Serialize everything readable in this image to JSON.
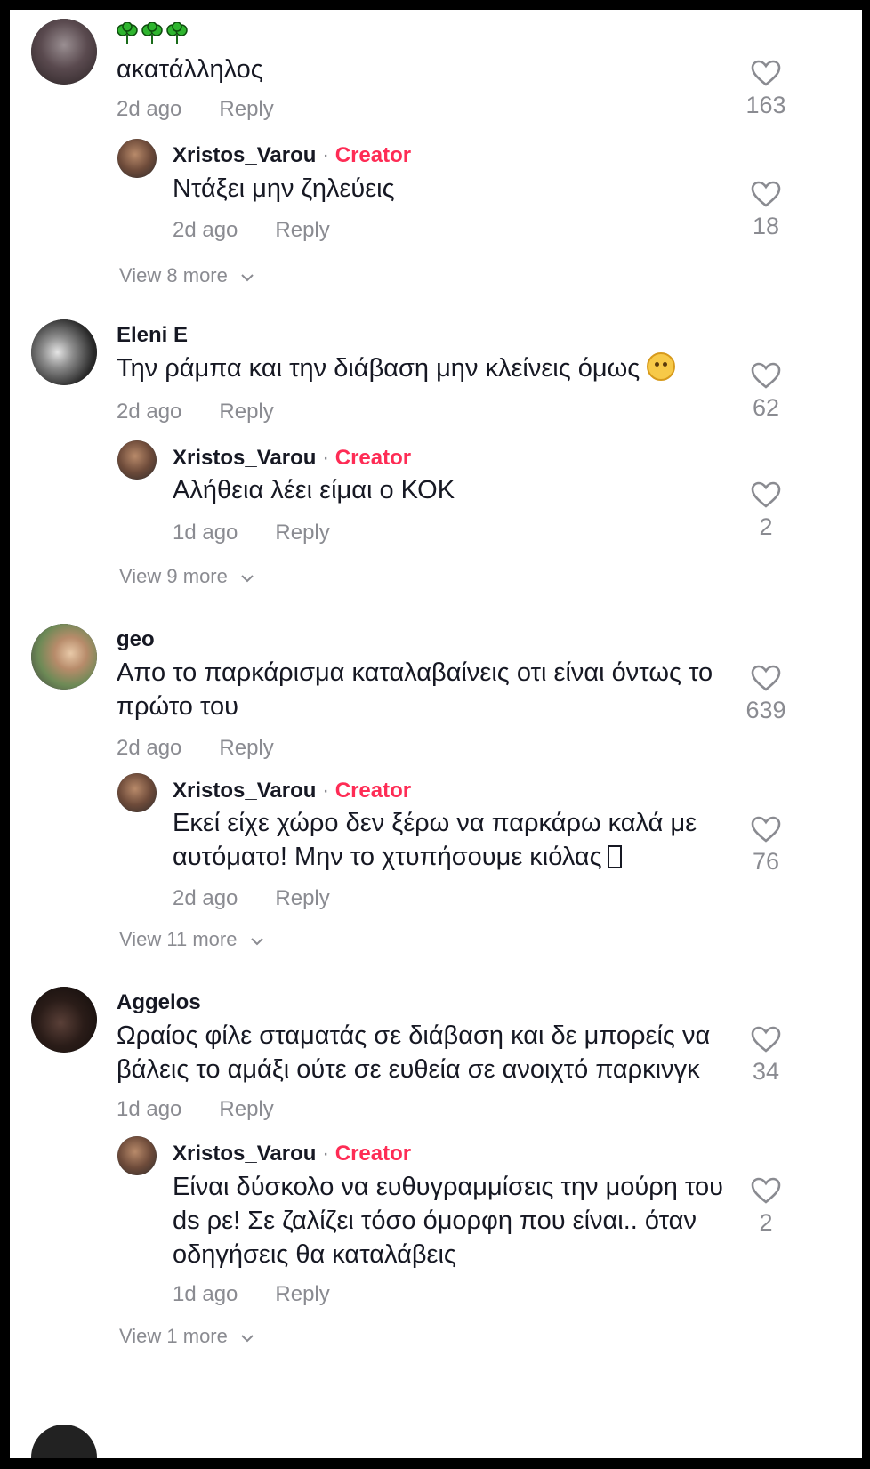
{
  "accent_color": "#fe2c55",
  "muted_color": "#8a8b91",
  "comments": [
    {
      "avatar_icon": "user-avatar",
      "username": "🍀🍀🍀",
      "text": "ακατάλληλος",
      "time": "2d ago",
      "reply_label": "Reply",
      "likes": "163",
      "reply": {
        "username": "Xristos_Varou",
        "separator": " · ",
        "creator_label": "Creator",
        "text": "Ντάξει μην ζηλεύεις",
        "time": "2d ago",
        "reply_label": "Reply",
        "likes": "18"
      },
      "view_more": "View 8 more"
    },
    {
      "username": "Eleni E",
      "text": "Την ράμπα και την διάβαση μην κλείνεις όμως",
      "time": "2d ago",
      "reply_label": "Reply",
      "likes": "62",
      "reply": {
        "username": "Xristos_Varou",
        "separator": " · ",
        "creator_label": "Creator",
        "text": "Αλήθεια λέει είμαι ο ΚΟΚ",
        "time": "1d ago",
        "reply_label": "Reply",
        "likes": "2"
      },
      "view_more": "View 9 more"
    },
    {
      "username": "geo",
      "text": "Απο το παρκάρισμα καταλαβαίνεις οτι είναι όντως το πρώτο του",
      "time": "2d ago",
      "reply_label": "Reply",
      "likes": "639",
      "reply": {
        "username": "Xristos_Varou",
        "separator": " · ",
        "creator_label": "Creator",
        "text": "Εκεί είχε χώρο δεν ξέρω να παρκάρω καλά με αυτόματο! Μην το χτυπήσουμε κιόλας",
        "time": "2d ago",
        "reply_label": "Reply",
        "likes": "76"
      },
      "view_more": "View 11 more"
    },
    {
      "username": "Aggelos",
      "text": "Ωραίος φίλε σταματάς σε διάβαση και δε μπορείς να βάλεις το αμάξι ούτε σε ευθεία σε ανοιχτό παρκινγκ",
      "time": "1d ago",
      "reply_label": "Reply",
      "likes": "34",
      "reply": {
        "username": "Xristos_Varou",
        "separator": " · ",
        "creator_label": "Creator",
        "text": "Είναι δύσκολο να ευθυγραμμίσεις την μούρη του ds ρε! Σε ζαλίζει τόσο όμορφη που είναι.. όταν οδηγήσεις θα καταλάβεις",
        "time": "1d ago",
        "reply_label": "Reply",
        "likes": "2"
      },
      "view_more": "View 1 more"
    }
  ]
}
